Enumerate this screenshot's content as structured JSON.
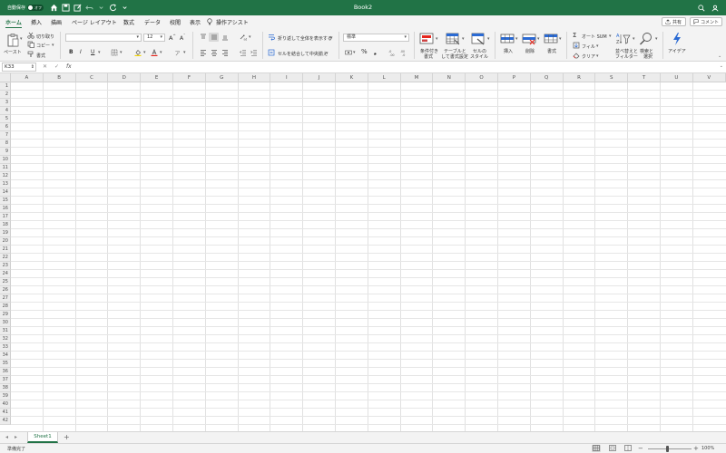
{
  "title_bar": {
    "autosave_label": "自動保存",
    "toggle_label": "オフ",
    "doc_title": "Book2"
  },
  "tabs": [
    {
      "label": "ホーム",
      "active": true
    },
    {
      "label": "挿入"
    },
    {
      "label": "描画"
    },
    {
      "label": "ページ レイアウト"
    },
    {
      "label": "数式"
    },
    {
      "label": "データ"
    },
    {
      "label": "校閲"
    },
    {
      "label": "表示"
    },
    {
      "label": "操作アシスト"
    }
  ],
  "share_label": "共有",
  "comment_label": "コメント",
  "ribbon": {
    "paste_label": "ペースト",
    "cut_label": "切り取り",
    "copy_label": "コピー",
    "format_painter_label": "書式",
    "font_name": "",
    "font_size": "12",
    "bold": "B",
    "italic": "I",
    "underline": "U",
    "wrap_text_label": "折り返して全体を表示する",
    "merge_center_label": "セルを結合して中央揃え",
    "number_format": "標準",
    "percent": "%",
    "conditional_format_label_1": "条件付き",
    "conditional_format_label_2": "書式",
    "table_format_label_1": "テーブルと",
    "table_format_label_2": "して書式設定",
    "cell_style_label_1": "セルの",
    "cell_style_label_2": "スタイル",
    "insert_label": "挿入",
    "delete_label": "削除",
    "format_label": "書式",
    "autosum_label": "オート SUM",
    "fill_label": "フィル",
    "clear_label": "クリア",
    "sort_filter_label_1": "並べ替えと",
    "sort_filter_label_2": "フィルター",
    "find_select_label_1": "検索と",
    "find_select_label_2": "選択",
    "ideas_label": "アイデア"
  },
  "formula_bar": {
    "name_box": "K33",
    "fx": "fx",
    "value": ""
  },
  "columns": [
    "A",
    "B",
    "C",
    "D",
    "E",
    "F",
    "G",
    "H",
    "I",
    "J",
    "K",
    "L",
    "M",
    "N",
    "O",
    "P",
    "Q",
    "R",
    "S",
    "T",
    "U",
    "V"
  ],
  "rows": [
    "1",
    "2",
    "3",
    "4",
    "5",
    "6",
    "7",
    "8",
    "9",
    "10",
    "11",
    "12",
    "13",
    "14",
    "15",
    "16",
    "17",
    "18",
    "19",
    "20",
    "21",
    "22",
    "23",
    "24",
    "25",
    "26",
    "27",
    "28",
    "29",
    "30",
    "31",
    "32",
    "33",
    "34",
    "35",
    "36",
    "37",
    "38",
    "39",
    "40",
    "41",
    "42"
  ],
  "sheets": [
    {
      "name": "Sheet1",
      "active": true
    }
  ],
  "add_sheet": "+",
  "status": {
    "ready_text": "準備完了",
    "zoom": "100%"
  },
  "colors": {
    "accent": "#217346",
    "ribbon_bg": "#f3f3f3",
    "header_bg": "#ececec"
  }
}
